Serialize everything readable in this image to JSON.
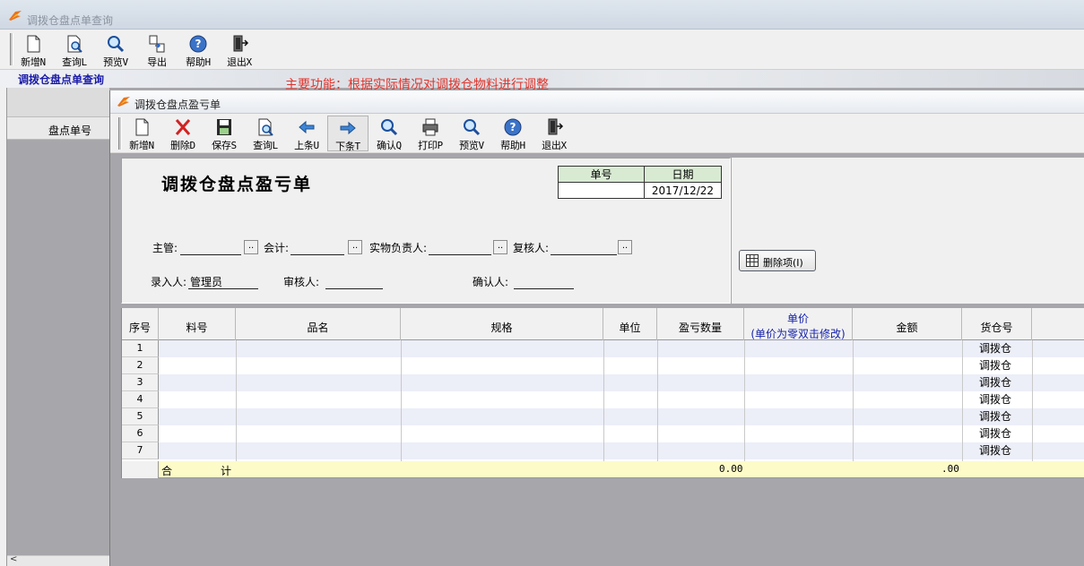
{
  "outer_window": {
    "title": "调拨仓盘点单查询",
    "toolbar": [
      {
        "label": "新增N",
        "icon": "new-doc-icon"
      },
      {
        "label": "查询L",
        "icon": "query-doc-icon"
      },
      {
        "label": "预览V",
        "icon": "magnifier-icon"
      },
      {
        "label": "导出",
        "icon": "export-icon"
      },
      {
        "label": "帮助H",
        "icon": "help-icon"
      },
      {
        "label": "退出X",
        "icon": "exit-icon"
      }
    ],
    "query_title": "调拨仓盘点单查询",
    "main_function": "主要功能：根据实际情况对调拨仓物料进行调整",
    "list_column": "盘点单号"
  },
  "inner_window": {
    "title": "调拨仓盘点盈亏单",
    "toolbar": [
      {
        "label": "新增N",
        "icon": "new-doc-icon"
      },
      {
        "label": "删除D",
        "icon": "delete-x-icon"
      },
      {
        "label": "保存S",
        "icon": "save-disk-icon"
      },
      {
        "label": "查询L",
        "icon": "query-doc-icon"
      },
      {
        "label": "上条U",
        "icon": "arrow-left-icon"
      },
      {
        "label": "下条T",
        "icon": "arrow-right-icon"
      },
      {
        "label": "确认Q",
        "icon": "magnifier-icon"
      },
      {
        "label": "打印P",
        "icon": "printer-icon"
      },
      {
        "label": "预览V",
        "icon": "magnifier-icon"
      },
      {
        "label": "帮助H",
        "icon": "help-icon"
      },
      {
        "label": "退出X",
        "icon": "exit-icon"
      }
    ],
    "form": {
      "title": "调拨仓盘点盈亏单",
      "doc_no_label": "单号",
      "date_label": "日期",
      "doc_no_value": "",
      "date_value": "2017/12/22",
      "supervisor_label": "主管:",
      "accountant_label": "会计:",
      "custodian_label": "实物负责人:",
      "reviewer_label": "复核人:",
      "entered_by_label": "录入人:",
      "entered_by_value": "管理员",
      "auditor_label": "审核人:",
      "confirmer_label": "确认人:",
      "dots": ".."
    },
    "delete_item_button": "删除项(I)",
    "grid": {
      "columns": [
        "序号",
        "料号",
        "品名",
        "规格",
        "单位",
        "盈亏数量",
        "单价",
        "(单价为零双击修改)",
        "金额",
        "货仓号"
      ],
      "rows": [
        {
          "no": "1",
          "warehouse": "调拨仓"
        },
        {
          "no": "2",
          "warehouse": "调拨仓"
        },
        {
          "no": "3",
          "warehouse": "调拨仓"
        },
        {
          "no": "4",
          "warehouse": "调拨仓"
        },
        {
          "no": "5",
          "warehouse": "调拨仓"
        },
        {
          "no": "6",
          "warehouse": "调拨仓"
        },
        {
          "no": "7",
          "warehouse": "调拨仓"
        }
      ],
      "total": {
        "he": "合",
        "ji": "计",
        "qty": "0.00",
        "amount": ".00"
      }
    }
  },
  "colors": {
    "accent_blue": "#1a1aa8",
    "warning_red": "#e0342c",
    "total_row": "#fdfbc8",
    "odd_row": "#eceef8"
  }
}
